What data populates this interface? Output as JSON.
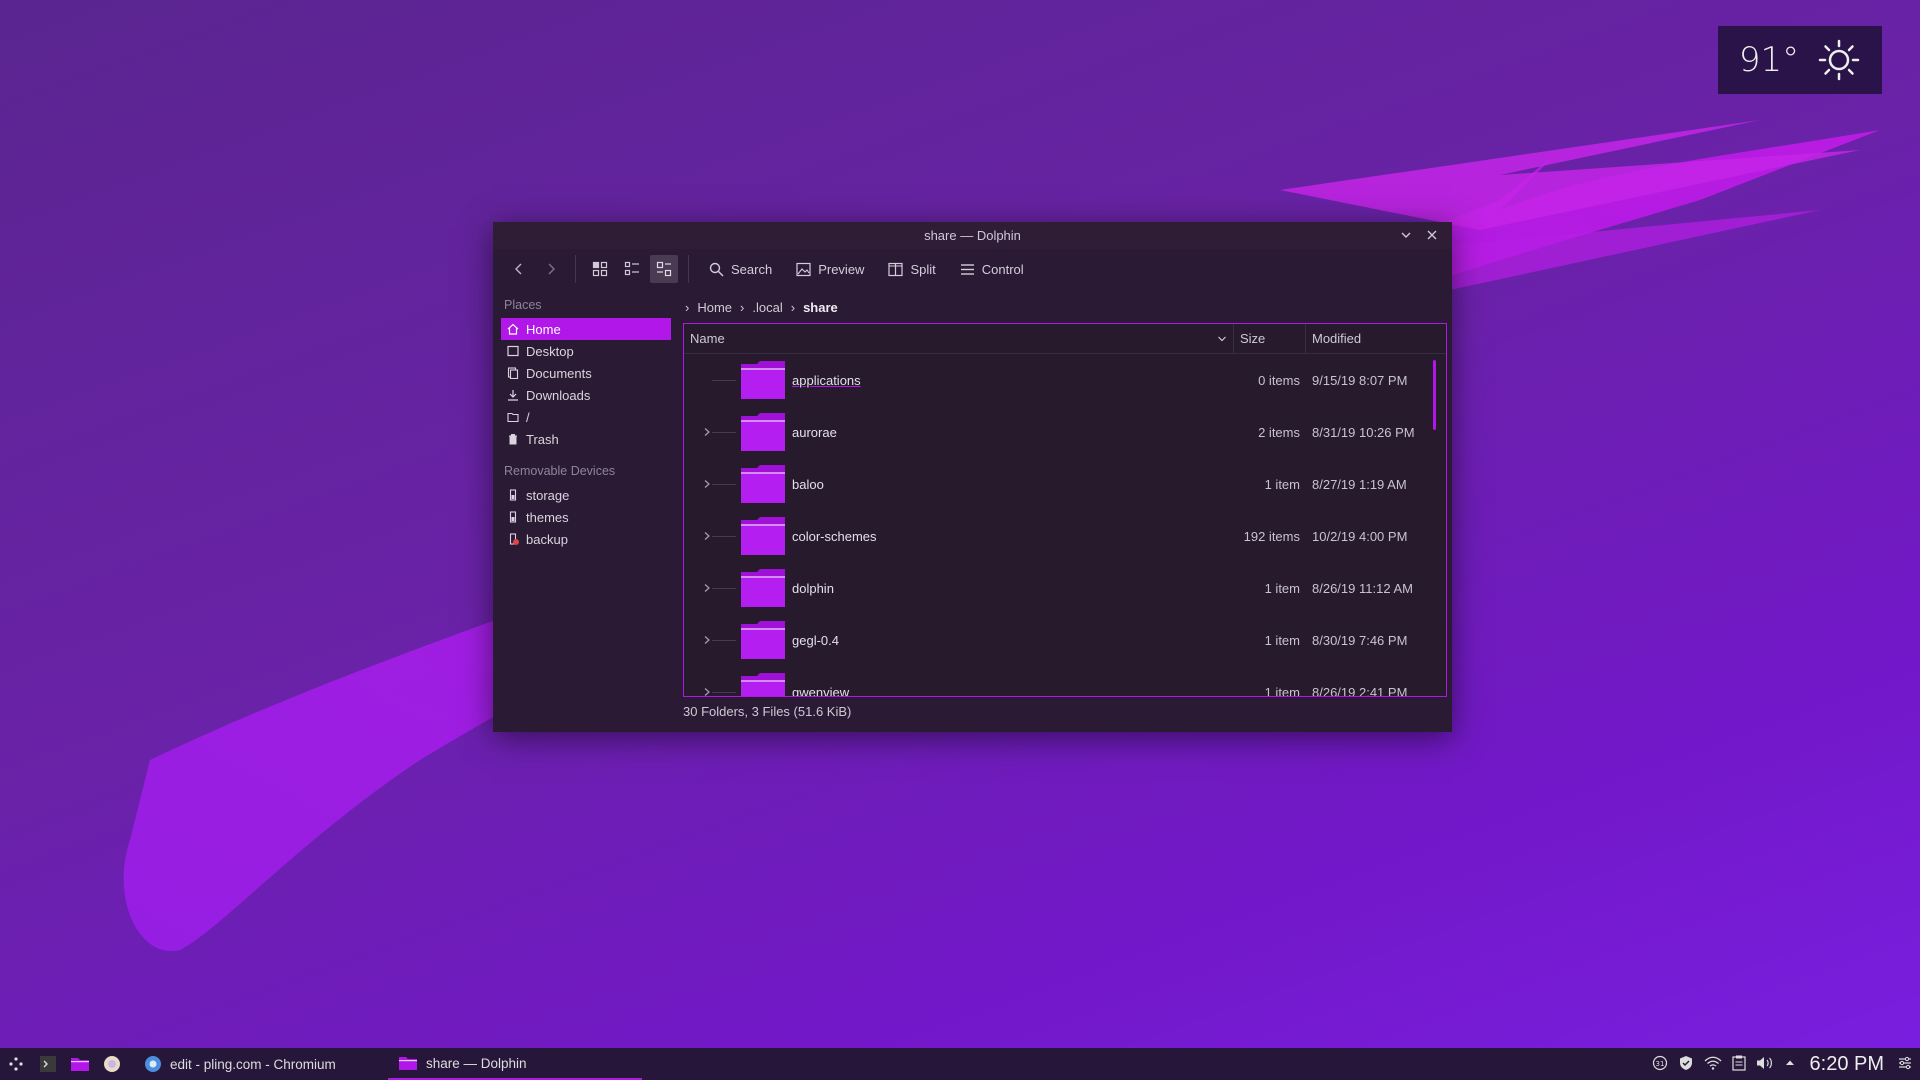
{
  "weather": {
    "temperature": "91°",
    "icon": "sun-icon"
  },
  "window": {
    "title": "share — Dolphin",
    "toolbar": {
      "search_label": "Search",
      "preview_label": "Preview",
      "split_label": "Split",
      "control_label": "Control"
    },
    "places": {
      "header": "Places",
      "items": [
        {
          "label": "Home",
          "icon": "home-icon"
        },
        {
          "label": "Desktop",
          "icon": "desktop-icon"
        },
        {
          "label": "Documents",
          "icon": "documents-icon"
        },
        {
          "label": "Downloads",
          "icon": "download-icon"
        },
        {
          "label": "/",
          "icon": "folder-icon"
        },
        {
          "label": "Trash",
          "icon": "trash-icon"
        }
      ],
      "removable_header": "Removable Devices",
      "devices": [
        {
          "label": "storage",
          "icon": "drive-icon"
        },
        {
          "label": "themes",
          "icon": "drive-icon"
        },
        {
          "label": "backup",
          "icon": "drive-error-icon"
        }
      ]
    },
    "breadcrumb": [
      "Home",
      ".local",
      "share"
    ],
    "columns": {
      "name": "Name",
      "size": "Size",
      "modified": "Modified"
    },
    "files": [
      {
        "name": "applications",
        "size": "0 items",
        "modified": "9/15/19 8:07 PM",
        "expandable": false
      },
      {
        "name": "aurorae",
        "size": "2 items",
        "modified": "8/31/19 10:26 PM",
        "expandable": true
      },
      {
        "name": "baloo",
        "size": "1 item",
        "modified": "8/27/19 1:19 AM",
        "expandable": true
      },
      {
        "name": "color-schemes",
        "size": "192 items",
        "modified": "10/2/19 4:00 PM",
        "expandable": true
      },
      {
        "name": "dolphin",
        "size": "1 item",
        "modified": "8/26/19 11:12 AM",
        "expandable": true
      },
      {
        "name": "gegl-0.4",
        "size": "1 item",
        "modified": "8/30/19 7:46 PM",
        "expandable": true
      },
      {
        "name": "gwenview",
        "size": "1 item",
        "modified": "8/26/19 2:41 PM",
        "expandable": true
      }
    ],
    "status": "30 Folders, 3 Files (51.6 KiB)"
  },
  "taskbar": {
    "tasks": [
      {
        "label": "edit - pling.com - Chromium",
        "icon": "chromium-icon"
      },
      {
        "label": "share — Dolphin",
        "icon": "dolphin-folder-icon"
      }
    ],
    "clock": "6:20 PM"
  },
  "colors": {
    "accent": "#b017e8",
    "window_bg": "#2b1a33",
    "panel": "#26173a"
  }
}
